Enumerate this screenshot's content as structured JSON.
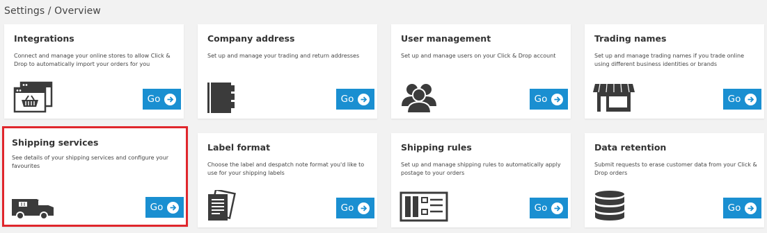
{
  "breadcrumb": "Settings / Overview",
  "colors": {
    "accent": "#1a8fd1",
    "highlight_border": "#e0262c",
    "icon": "#3b3b3b"
  },
  "cards": [
    {
      "title": "Integrations",
      "description": "Connect and manage your online stores to allow Click & Drop to automatically import your orders for you",
      "icon": "online-store-icon",
      "button": "Go"
    },
    {
      "title": "Company address",
      "description": "Set up and manage your trading and return addresses",
      "icon": "address-book-icon",
      "button": "Go"
    },
    {
      "title": "User management",
      "description": "Set up and manage users on your Click & Drop account",
      "icon": "users-icon",
      "button": "Go"
    },
    {
      "title": "Trading names",
      "description": "Set up and manage trading names if you trade online using different business identities or brands",
      "icon": "storefront-icon",
      "button": "Go"
    },
    {
      "title": "Shipping services",
      "description": "See details of your shipping services and configure your favourites",
      "icon": "delivery-van-icon",
      "button": "Go",
      "highlighted": true
    },
    {
      "title": "Label format",
      "description": "Choose the label and despatch note format you'd like to use for your shipping labels",
      "icon": "documents-icon",
      "button": "Go"
    },
    {
      "title": "Shipping rules",
      "description": "Set up and manage shipping rules to automatically apply postage to your orders",
      "icon": "rules-board-icon",
      "button": "Go"
    },
    {
      "title": "Data retention",
      "description": "Submit requests to erase customer data from your Click & Drop orders",
      "icon": "database-icon",
      "button": "Go"
    }
  ]
}
